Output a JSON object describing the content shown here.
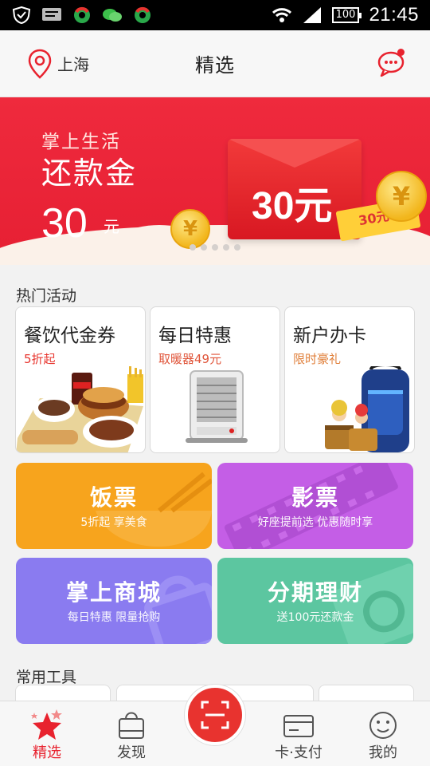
{
  "status_bar": {
    "time": "21:45",
    "battery": "100",
    "icons": [
      "shield-icon",
      "message-icon",
      "app-icon",
      "wechat-icon",
      "app-icon",
      "wifi-icon",
      "signal-icon",
      "battery-icon"
    ]
  },
  "header": {
    "location": "上海",
    "title": "精选",
    "icons": [
      "location-pin-icon",
      "chat-bubble-icon"
    ],
    "accent": "#e8222e"
  },
  "banner": {
    "subtitle": "掌上生活",
    "headline": "还款金",
    "amount": "30",
    "unit": "元",
    "envelope_text": "30元",
    "ticket_text": "30元",
    "coin_symbol": "¥",
    "page_count": 5,
    "active_page": 1,
    "background": "#ea2338"
  },
  "hot": {
    "label": "热门活动",
    "cards": [
      {
        "title": "餐饮代金券",
        "sub": "5折起",
        "sub_color": "#e8352e"
      },
      {
        "title": "每日特惠",
        "sub": "取暖器49元",
        "sub_color": "#e0553a"
      },
      {
        "title": "新户办卡",
        "sub": "限时豪礼",
        "sub_color": "#e07f3a"
      }
    ]
  },
  "tiles": [
    {
      "title": "饭票",
      "sub": "5折起 享美食",
      "color": "#f7a41d"
    },
    {
      "title": "影票",
      "sub": "好座提前选 优惠随时享",
      "color": "#c45ee6"
    },
    {
      "title": "掌上商城",
      "sub": "每日特惠 限量抢购",
      "color": "#8a7bf0"
    },
    {
      "title": "分期理财",
      "sub": "送100元还款金",
      "color": "#5cc6a0"
    }
  ],
  "tools": {
    "label": "常用工具"
  },
  "bottom_nav": {
    "items": [
      {
        "label": "精选",
        "icon": "star-icon",
        "active": true
      },
      {
        "label": "发现",
        "icon": "bag-icon",
        "active": false
      },
      {
        "label": "卡·支付",
        "icon": "card-icon",
        "active": false
      },
      {
        "label": "我的",
        "icon": "smile-icon",
        "active": false
      }
    ],
    "center_icon": "scan-icon"
  }
}
